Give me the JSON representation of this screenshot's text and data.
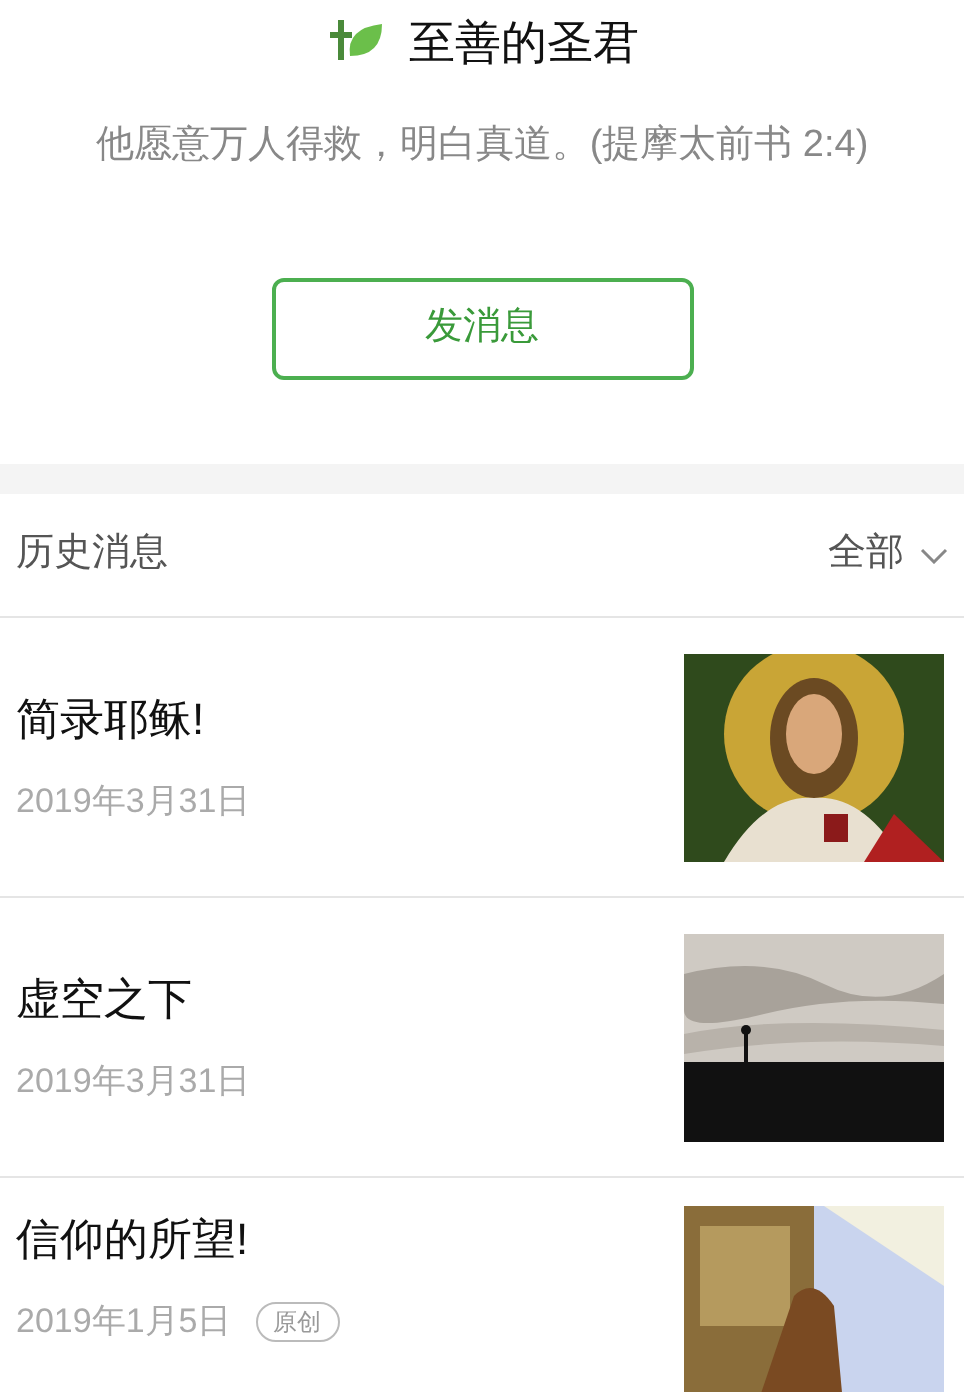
{
  "account": {
    "name": "至善的圣君",
    "motto": "他愿意万人得救，明白真道。(提摩太前书 2:4)",
    "button": "发消息"
  },
  "history": {
    "title": "历史消息",
    "filter": "全部"
  },
  "articles": [
    {
      "title": "简录耶稣!",
      "date": "2019年3月31日",
      "kind": "picture"
    },
    {
      "title": "虚空之下",
      "date": "2019年3月31日",
      "kind": "picture"
    },
    {
      "title": "信仰的所望!",
      "date": "2019年1月5日",
      "badge": "原创",
      "kind": "picture"
    }
  ]
}
